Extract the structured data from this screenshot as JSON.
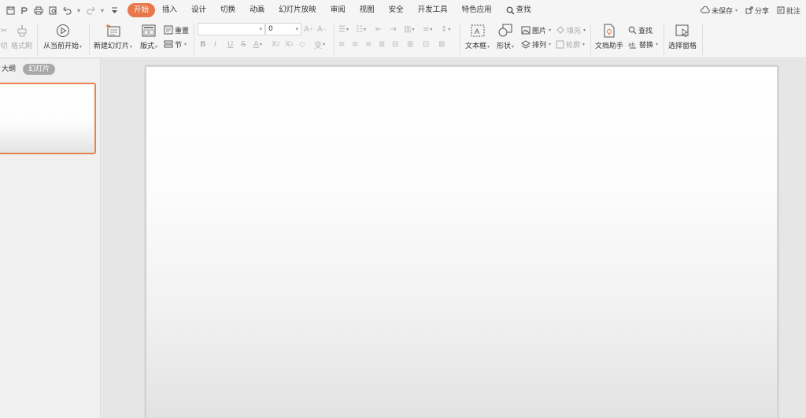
{
  "menu": {
    "tabs": [
      "开始",
      "插入",
      "设计",
      "切换",
      "动画",
      "幻灯片放映",
      "审阅",
      "视图",
      "安全",
      "开发工具",
      "特色应用"
    ],
    "search_label": "查找",
    "right": {
      "save_status": "未保存",
      "share": "分享",
      "comment": "批注"
    }
  },
  "ribbon": {
    "format_painter": "格式刷",
    "from_current": "从当前开始",
    "new_slide": "新建幻灯片",
    "layout": "版式",
    "reset": "重置",
    "section": "节",
    "font_size": "0",
    "textbox": "文本框",
    "shape": "形状",
    "picture": "图片",
    "fill": "填充",
    "arrange": "排列",
    "outline": "轮廓",
    "doc_assistant": "文档助手",
    "find": "查找",
    "replace": "替换",
    "selection_pane": "选择窗格"
  },
  "panel": {
    "outline_tab": "大纲",
    "slides_tab": "幻灯片"
  },
  "colors": {
    "accent": "#e8774a",
    "selection_border": "#e38452"
  }
}
